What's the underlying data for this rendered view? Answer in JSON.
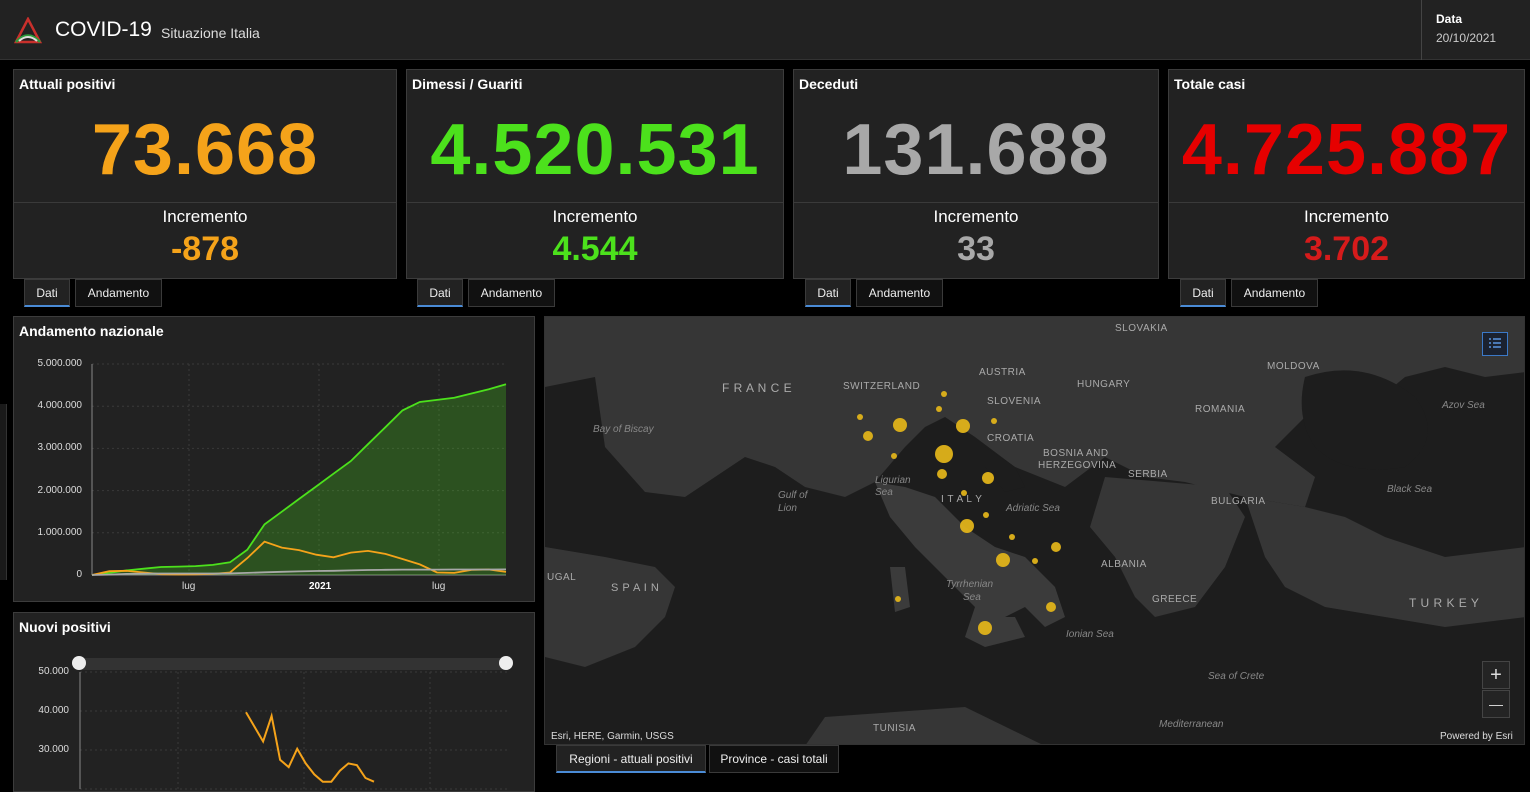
{
  "header": {
    "title": "COVID-19",
    "subtitle": "Situazione Italia",
    "date_label": "Data",
    "date_value": "20/10/2021"
  },
  "cards": [
    {
      "title": "Attuali positivi",
      "value": "73.668",
      "inc_label": "Incremento",
      "inc_value": "-878",
      "color": "#f5a31a",
      "inc_color": "#f5a31a"
    },
    {
      "title": "Dimessi / Guariti",
      "value": "4.520.531",
      "inc_label": "Incremento",
      "inc_value": "4.544",
      "color": "#4ce11c",
      "inc_color": "#4ce11c"
    },
    {
      "title": "Deceduti",
      "value": "131.688",
      "inc_label": "Incremento",
      "inc_value": "33",
      "color": "#a8a8a8",
      "inc_color": "#a8a8a8"
    },
    {
      "title": "Totale casi",
      "value": "4.725.887",
      "inc_label": "Incremento",
      "inc_value": "3.702",
      "color": "#e60000",
      "inc_color": "#d61b1b"
    }
  ],
  "card_tabs": {
    "dati": "Dati",
    "andamento": "Andamento"
  },
  "trend_panel": {
    "title": "Andamento nazionale",
    "chart_data": {
      "type": "area",
      "x_tick_labels": [
        "lug",
        "2021",
        "lug"
      ],
      "y_tick_labels": [
        "5.000.000",
        "4.000.000",
        "3.000.000",
        "2.000.000",
        "1.000.000",
        "0"
      ],
      "ylim": [
        0,
        5000000
      ],
      "grid": true,
      "series": [
        {
          "name": "Dimessi / Guariti",
          "color": "#4ce11c",
          "values": [
            0,
            50000,
            110000,
            150000,
            190000,
            200000,
            210000,
            240000,
            300000,
            600000,
            1200000,
            1500000,
            1800000,
            2100000,
            2400000,
            2700000,
            3100000,
            3500000,
            3900000,
            4100000,
            4150000,
            4200000,
            4300000,
            4400000,
            4520531
          ]
        },
        {
          "name": "Attuali positivi",
          "color": "#f5a31a",
          "values": [
            0,
            90000,
            100000,
            60000,
            20000,
            12000,
            14000,
            25000,
            60000,
            400000,
            790000,
            650000,
            590000,
            480000,
            420000,
            530000,
            570000,
            500000,
            380000,
            250000,
            60000,
            50000,
            120000,
            130000,
            73668
          ]
        },
        {
          "name": "Deceduti",
          "color": "#a8a8a8",
          "values": [
            0,
            10000,
            25000,
            33000,
            35000,
            35500,
            35800,
            36000,
            38000,
            50000,
            65000,
            75000,
            85000,
            95000,
            100000,
            110000,
            118000,
            124000,
            127000,
            128000,
            129000,
            130000,
            130500,
            131000,
            131688
          ]
        }
      ]
    }
  },
  "new_cases_panel": {
    "title": "Nuovi positivi",
    "chart_data": {
      "type": "line",
      "y_tick_labels": [
        "50.000",
        "40.000",
        "30.000"
      ],
      "ylim": [
        20000,
        52000
      ],
      "grid": true,
      "series": [
        {
          "color": "#f5a31a",
          "values": [
            41000,
            37000,
            33000,
            40000,
            28000,
            26000,
            31000,
            27000,
            24000,
            22000,
            22000,
            25000,
            27000,
            26500,
            23000,
            22000
          ]
        }
      ]
    }
  },
  "map": {
    "attribution": "Esri, HERE, Garmin, USGS",
    "powered": "Powered by Esri",
    "zoom_in": "+",
    "zoom_out": "—",
    "country_labels": [
      "SLOVAKIA",
      "AUSTRIA",
      "HUNGARY",
      "MOLDOVA",
      "F R A N C E",
      "SWITZERLAND",
      "SLOVENIA",
      "ROMANIA",
      "CROATIA",
      "BOSNIA AND",
      "HERZEGOVINA",
      "SERBIA",
      "I T A L Y",
      "BULGARIA",
      "S P A I N",
      "ALBANIA",
      "GREECE",
      "T U R K E Y",
      "UGAL",
      "TUNISIA"
    ],
    "sea_labels": [
      "Bay of Biscay",
      "Ligurian",
      "Sea",
      "Gulf of",
      "Lion",
      "Adriatic Sea",
      "Tyrrhenian",
      "Sea",
      "Ionian Sea",
      "Sea of Crete",
      "Mediterranean",
      "Azov Sea",
      "Black Sea"
    ],
    "tabs": [
      "Regioni - attuali positivi",
      "Province - casi totali"
    ]
  }
}
